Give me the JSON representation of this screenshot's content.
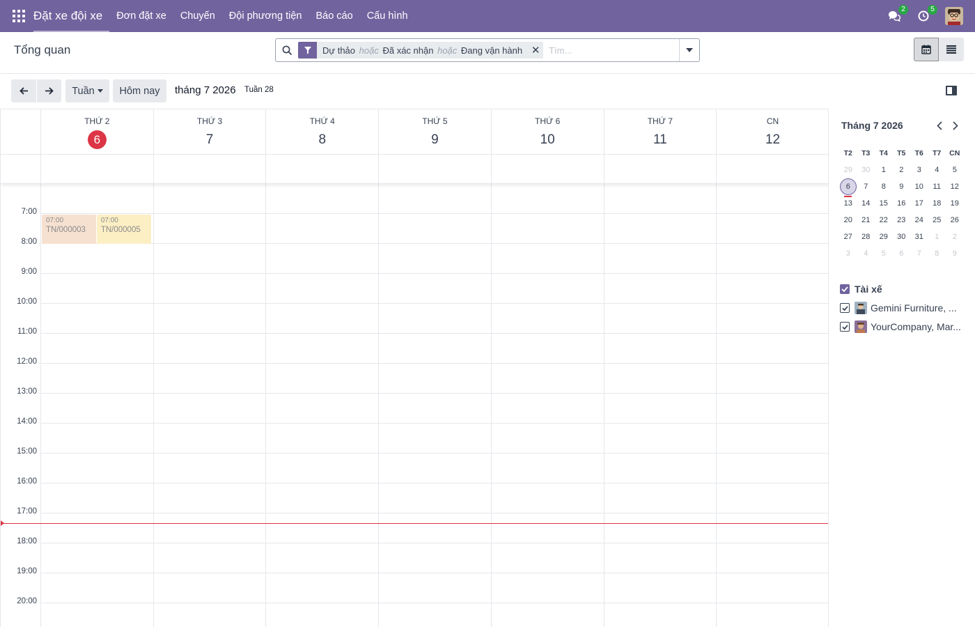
{
  "navbar": {
    "app_title": "Đặt xe đội xe",
    "menu": [
      "Đơn đặt xe",
      "Chuyến",
      "Đội phương tiện",
      "Báo cáo",
      "Cấu hình"
    ],
    "messages_count": "2",
    "activities_count": "5"
  },
  "control": {
    "breadcrumb": "Tổng quan",
    "facet": {
      "v1": "Dự thảo",
      "sep1": "hoặc",
      "v2": "Đã xác nhận",
      "sep2": "hoặc",
      "v3": "Đang vận hành"
    },
    "search_placeholder": "Tìm..."
  },
  "toolbar": {
    "scale_label": "Tuần",
    "today_label": "Hôm nay",
    "period": "tháng 7 2026",
    "week_label": "Tuần 28"
  },
  "calendar": {
    "days": [
      {
        "name": "THỨ 2",
        "num": "6"
      },
      {
        "name": "THỨ 3",
        "num": "7"
      },
      {
        "name": "THỨ 4",
        "num": "8"
      },
      {
        "name": "THỨ 5",
        "num": "9"
      },
      {
        "name": "THỨ 6",
        "num": "10"
      },
      {
        "name": "THỨ 7",
        "num": "11"
      },
      {
        "name": "CN",
        "num": "12"
      }
    ],
    "hours": [
      "7:00",
      "8:00",
      "9:00",
      "10:00",
      "11:00",
      "12:00",
      "13:00",
      "14:00",
      "15:00",
      "16:00",
      "17:00",
      "18:00",
      "19:00",
      "20:00"
    ],
    "events": [
      {
        "time": "07:00",
        "name": "TN/000003",
        "color": "#f6e1d1"
      },
      {
        "time": "07:00",
        "name": "TN/000005",
        "color": "#fcefc4"
      }
    ]
  },
  "mini_calendar": {
    "title": "Tháng 7 2026",
    "weekdays": [
      "T2",
      "T3",
      "T4",
      "T5",
      "T6",
      "T7",
      "CN"
    ],
    "weeks": [
      [
        "29",
        "30",
        "1",
        "2",
        "3",
        "4",
        "5"
      ],
      [
        "6",
        "7",
        "8",
        "9",
        "10",
        "11",
        "12"
      ],
      [
        "13",
        "14",
        "15",
        "16",
        "17",
        "18",
        "19"
      ],
      [
        "20",
        "21",
        "22",
        "23",
        "24",
        "25",
        "26"
      ],
      [
        "27",
        "28",
        "29",
        "30",
        "31",
        "1",
        "2"
      ],
      [
        "3",
        "4",
        "5",
        "6",
        "7",
        "8",
        "9"
      ]
    ]
  },
  "filters": {
    "title": "Tài xế",
    "items": [
      {
        "label": "Gemini Furniture, ..."
      },
      {
        "label": "YourCompany, Mar..."
      }
    ]
  },
  "colors": {
    "brand": "#71639e",
    "today": "#dc3545"
  }
}
